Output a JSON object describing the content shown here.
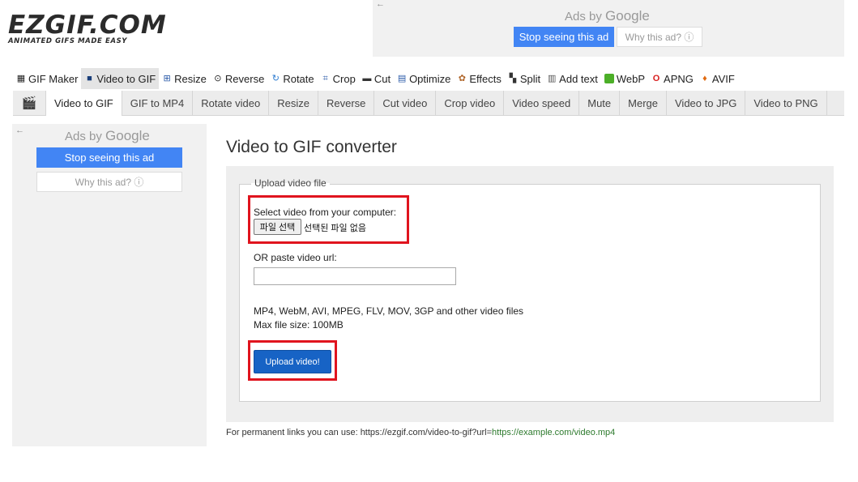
{
  "logo": {
    "main": "EZGIF.COM",
    "tagline": "ANIMATED GIFS MADE EASY"
  },
  "ads": {
    "ads_by": "Ads by",
    "google": "Google",
    "stop_seeing": "Stop seeing this ad",
    "why_this_ad": "Why this ad? ⓘ",
    "back_arrow": "←"
  },
  "main_nav": [
    {
      "label": "GIF Maker",
      "icon": "gif-maker-icon"
    },
    {
      "label": "Video to GIF",
      "icon": "video-icon",
      "active": true
    },
    {
      "label": "Resize",
      "icon": "resize-icon"
    },
    {
      "label": "Reverse",
      "icon": "reverse-icon"
    },
    {
      "label": "Rotate",
      "icon": "rotate-icon"
    },
    {
      "label": "Crop",
      "icon": "crop-icon"
    },
    {
      "label": "Cut",
      "icon": "cut-icon"
    },
    {
      "label": "Optimize",
      "icon": "optimize-icon"
    },
    {
      "label": "Effects",
      "icon": "effects-icon"
    },
    {
      "label": "Split",
      "icon": "split-icon"
    },
    {
      "label": "Add text",
      "icon": "add-text-icon"
    },
    {
      "label": "WebP",
      "icon": "webp-icon"
    },
    {
      "label": "APNG",
      "icon": "apng-icon"
    },
    {
      "label": "AVIF",
      "icon": "avif-icon"
    }
  ],
  "sub_nav": [
    "Video to GIF",
    "GIF to MP4",
    "Rotate video",
    "Resize",
    "Reverse",
    "Cut video",
    "Crop video",
    "Video speed",
    "Mute",
    "Merge",
    "Video to JPG",
    "Video to PNG"
  ],
  "main": {
    "title": "Video to GIF converter",
    "legend": "Upload video file",
    "select_label": "Select video from your computer:",
    "file_button": "파일 선택",
    "file_status": "선택된 파일 없음",
    "url_label": "OR paste video url:",
    "url_placeholder": "",
    "formats": "MP4, WebM, AVI, MPEG, FLV, MOV, 3GP and other video files",
    "max_size": "Max file size: 100MB",
    "upload_button": "Upload video!",
    "perm_prefix": "For permanent links you can use: https://ezgif.com/video-to-gif?url=",
    "perm_example": "https://example.com/video.mp4"
  },
  "colors": {
    "accent_blue": "#1763c5",
    "google_blue": "#4285f4",
    "highlight_red": "#e0141e"
  }
}
